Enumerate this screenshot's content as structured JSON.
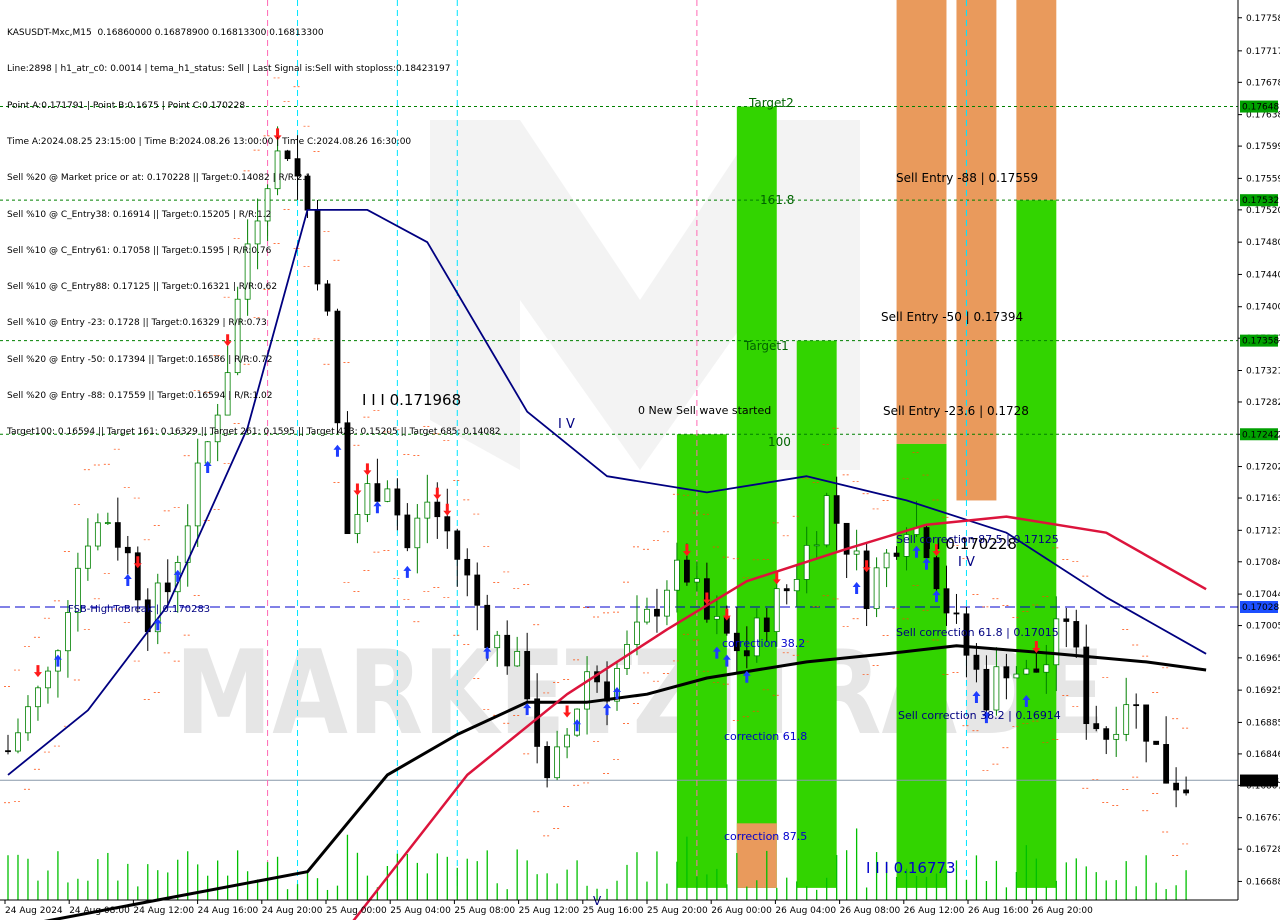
{
  "header": {
    "symbol_line": "KASUSDT-Mxc,M15  0.16860000 0.16878900 0.16813300 0.16813300",
    "lines": [
      "Line:2898 | h1_atr_c0: 0.0014 | tema_h1_status: Sell | Last Signal is:Sell with stoploss:0.18423197",
      "Point A:0.171791 | Point B:0.1675 | Point C:0.170228",
      "Time A:2024.08.25 23:15:00 | Time B:2024.08.26 13:00:00 | Time C:2024.08.26 16:30:00",
      "Sell %20 @ Market price or at: 0.170228 || Target:0.14082 | R/R:2.1",
      "Sell %10 @ C_Entry38: 0.16914 || Target:0.15205 | R/R:1.2",
      "Sell %10 @ C_Entry61: 0.17058 || Target:0.1595 | R/R:0.76",
      "Sell %10 @ C_Entry88: 0.17125 || Target:0.16321 | R/R:0.62",
      "Sell %10 @ Entry -23: 0.1728 || Target:0.16329 | R/R:0.73",
      "Sell %20 @ Entry -50: 0.17394 || Target:0.16586 | R/R:0.72",
      "Sell %20 @ Entry -88: 0.17559 || Target:0.16594 | R/R:1.02",
      "Target100: 0.16594 || Target 161: 0.16329 || Target 261: 0.1595 || Target 423: 0.15205 || Target 685: 0.14082",
      ""
    ]
  },
  "colors": {
    "background": "#ffffff",
    "bull_candle": "#008000",
    "bear_candle": "#000000",
    "volume": "#00c000",
    "green_zone": "#32d400",
    "orange_zone": "#e99a5c",
    "level_line": "#008000",
    "current_line": "#0000cc",
    "ma_slow": "#000000",
    "ma_mid": "#000080",
    "ma_red": "#dc143c",
    "envelope": "#ff4500",
    "label_green_bg": "#00a000"
  },
  "price_axis": {
    "ticks": [
      "0.17758",
      "0.17717",
      "0.17678",
      "0.17638",
      "0.17599",
      "0.17559",
      "0.17520",
      "0.17480",
      "0.17440",
      "0.17400",
      "0.17361",
      "0.17321",
      "0.17282",
      "0.17242",
      "0.17202",
      "0.17163",
      "0.17123",
      "0.17084",
      "0.17044",
      "0.17005",
      "0.16965",
      "0.16925",
      "0.16885",
      "0.16846",
      "0.16807",
      "0.16767",
      "0.16728",
      "0.16688"
    ],
    "highlighted": [
      {
        "label": "0.17648",
        "kind": "level"
      },
      {
        "label": "0.17532",
        "kind": "level"
      },
      {
        "label": "0.17358",
        "kind": "level"
      },
      {
        "label": "0.17242",
        "kind": "level"
      },
      {
        "label": "0.17028",
        "kind": "current"
      },
      {
        "label": "0.16813",
        "kind": "last"
      }
    ]
  },
  "time_axis": {
    "ticks": [
      "24 Aug 2024",
      "24 Aug 08:00",
      "24 Aug 12:00",
      "24 Aug 16:00",
      "24 Aug 20:00",
      "25 Aug 00:00",
      "25 Aug 04:00",
      "25 Aug 08:00",
      "25 Aug 12:00",
      "25 Aug 16:00",
      "25 Aug 20:00",
      "26 Aug 00:00",
      "26 Aug 04:00",
      "26 Aug 08:00",
      "26 Aug 12:00",
      "26 Aug 16:00",
      "26 Aug 20:00"
    ]
  },
  "annotations": {
    "target2": "Target2",
    "fib_1618": "161.8",
    "target1": "Target1",
    "fib_100": "100",
    "new_wave": "0 New Sell wave started",
    "wave_iv_left": "I V",
    "point_a": "I I I 0.171968",
    "point_c": "I I 0.170228",
    "wave_iv_right": "I V",
    "point_b": "I I I 0.16773",
    "sell_entry_88": "Sell Entry -88 | 0.17559",
    "sell_entry_50": "Sell Entry -50 | 0.17394",
    "sell_entry_23": "Sell Entry -23.6 | 0.1728",
    "sell_corr_875": "Sell correction 87.5 | 0.17125",
    "sell_corr_618": "Sell correction 61.8 | 0.17015",
    "sell_corr_382": "Sell correction 38.2 | 0.16914",
    "corr_382": "correction 38.2",
    "corr_618": "correction 61.8",
    "corr_875": "correction 87.5",
    "fsb": "FSB-HighToBreak | 0.170283",
    "wave_v": "V",
    "watermark": "MARKETZITRADE"
  },
  "chart_data": {
    "type": "candlestick",
    "symbol": "KASUSDT-Mxc",
    "timeframe": "M15",
    "ylim": [
      0.16665,
      0.1778
    ],
    "last_price": 0.168133,
    "levels": [
      0.17648,
      0.17532,
      0.17358,
      0.17242
    ],
    "current_level": 0.17028,
    "points": {
      "A": 0.171791,
      "B": 0.1675,
      "C": 0.170228
    },
    "sell_entries": [
      0.17559,
      0.17394,
      0.1728
    ],
    "sell_corrections": [
      0.17125,
      0.17015,
      0.16914
    ],
    "targets": [
      0.16594,
      0.16329,
      0.1595,
      0.15205,
      0.14082
    ],
    "close_path": [
      [
        0,
        0.1685
      ],
      [
        2,
        0.169
      ],
      [
        4,
        0.1694
      ],
      [
        6,
        0.1704
      ],
      [
        8,
        0.1712
      ],
      [
        10,
        0.1714
      ],
      [
        12,
        0.1709
      ],
      [
        14,
        0.1702
      ],
      [
        16,
        0.1705
      ],
      [
        18,
        0.1714
      ],
      [
        20,
        0.1723
      ],
      [
        22,
        0.1733
      ],
      [
        24,
        0.1748
      ],
      [
        26,
        0.1757
      ],
      [
        28,
        0.176
      ],
      [
        30,
        0.1752
      ],
      [
        32,
        0.1738
      ],
      [
        34,
        0.1712
      ],
      [
        36,
        0.1717
      ],
      [
        38,
        0.1719
      ],
      [
        40,
        0.171
      ],
      [
        42,
        0.1716
      ],
      [
        44,
        0.1712
      ],
      [
        46,
        0.1706
      ],
      [
        48,
        0.17
      ],
      [
        50,
        0.1697
      ],
      [
        52,
        0.1693
      ],
      [
        54,
        0.168
      ],
      [
        56,
        0.1687
      ],
      [
        58,
        0.1695
      ],
      [
        60,
        0.1693
      ],
      [
        62,
        0.1697
      ],
      [
        64,
        0.1701
      ],
      [
        66,
        0.1706
      ],
      [
        68,
        0.1707
      ],
      [
        70,
        0.1701
      ],
      [
        72,
        0.1699
      ],
      [
        74,
        0.1697
      ],
      [
        76,
        0.1702
      ],
      [
        78,
        0.1705
      ],
      [
        80,
        0.171
      ],
      [
        82,
        0.1716
      ],
      [
        84,
        0.1711
      ],
      [
        86,
        0.1705
      ],
      [
        88,
        0.1709
      ],
      [
        90,
        0.1714
      ],
      [
        92,
        0.1711
      ],
      [
        94,
        0.1703
      ],
      [
        96,
        0.1697
      ],
      [
        98,
        0.1692
      ],
      [
        100,
        0.1696
      ],
      [
        102,
        0.1694
      ],
      [
        104,
        0.1696
      ],
      [
        106,
        0.1702
      ],
      [
        108,
        0.169
      ],
      [
        110,
        0.1687
      ],
      [
        112,
        0.1692
      ],
      [
        114,
        0.1688
      ],
      [
        116,
        0.1682
      ],
      [
        118,
        0.1681
      ]
    ],
    "curve_vertices": {
      "ma_slow": [
        [
          0,
          0.1663
        ],
        [
          30,
          0.167
        ],
        [
          38,
          0.1682
        ],
        [
          45,
          0.1687
        ],
        [
          52,
          0.1691
        ],
        [
          58,
          0.1691
        ],
        [
          64,
          0.1692
        ],
        [
          70,
          0.1694
        ],
        [
          80,
          0.1696
        ],
        [
          88,
          0.1697
        ],
        [
          95,
          0.1698
        ],
        [
          105,
          0.1697
        ],
        [
          114,
          0.1696
        ],
        [
          120,
          0.1695
        ]
      ],
      "ma_mid": [
        [
          0,
          0.1682
        ],
        [
          8,
          0.169
        ],
        [
          16,
          0.1703
        ],
        [
          24,
          0.1725
        ],
        [
          30,
          0.1752
        ],
        [
          36,
          0.1752
        ],
        [
          42,
          0.1748
        ],
        [
          52,
          0.1727
        ],
        [
          60,
          0.1719
        ],
        [
          70,
          0.1717
        ],
        [
          80,
          0.1719
        ],
        [
          90,
          0.1716
        ],
        [
          100,
          0.1712
        ],
        [
          110,
          0.1704
        ],
        [
          120,
          0.1697
        ]
      ],
      "ma_red": [
        [
          34,
          0.1663
        ],
        [
          46,
          0.1682
        ],
        [
          56,
          0.1692
        ],
        [
          66,
          0.17
        ],
        [
          74,
          0.1706
        ],
        [
          84,
          0.171
        ],
        [
          92,
          0.1713
        ],
        [
          100,
          0.1714
        ],
        [
          110,
          0.1712
        ],
        [
          120,
          0.1705
        ]
      ]
    },
    "zones": [
      {
        "name": "green-zone-1",
        "color": "green",
        "x": [
          67,
          72
        ],
        "y": [
          0.1668,
          0.17242
        ]
      },
      {
        "name": "green-zone-2",
        "color": "green",
        "x": [
          73,
          77
        ],
        "y": [
          0.1668,
          0.17648
        ]
      },
      {
        "name": "orange-zone-2",
        "color": "orange",
        "x": [
          73,
          77
        ],
        "y": [
          0.1668,
          0.1676
        ]
      },
      {
        "name": "green-zone-3",
        "color": "green",
        "x": [
          79,
          83
        ],
        "y": [
          0.1668,
          0.17358
        ]
      },
      {
        "name": "orange-zone-4",
        "color": "orange",
        "x": [
          89,
          94
        ],
        "y": [
          0.1723,
          0.1778
        ]
      },
      {
        "name": "green-zone-4",
        "color": "green",
        "x": [
          89,
          94
        ],
        "y": [
          0.1668,
          0.1723
        ]
      },
      {
        "name": "orange-zone-5",
        "color": "orange",
        "x": [
          95,
          99
        ],
        "y": [
          0.1716,
          0.1778
        ]
      },
      {
        "name": "orange-zone-6",
        "color": "orange",
        "x": [
          101,
          105
        ],
        "y": [
          0.17532,
          0.1778
        ]
      },
      {
        "name": "green-zone-6",
        "color": "green",
        "x": [
          101,
          105
        ],
        "y": [
          0.1668,
          0.17532
        ]
      }
    ]
  }
}
